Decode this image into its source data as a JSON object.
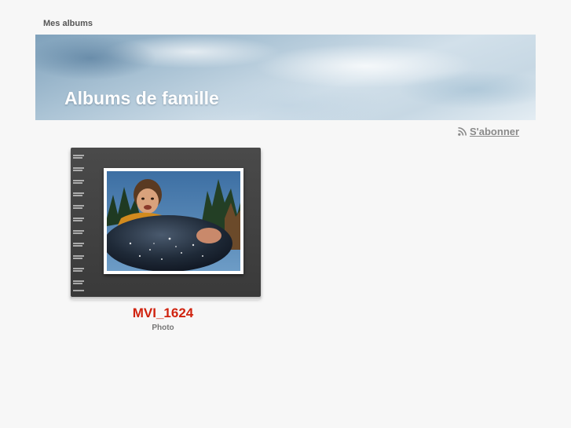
{
  "breadcrumb": {
    "label": "Mes albums"
  },
  "banner": {
    "title": "Albums de famille"
  },
  "subscribe": {
    "label": "S'abonner",
    "icon": "rss-icon"
  },
  "albums": [
    {
      "title": "MVI_1624",
      "type": "Photo",
      "thumbnail": "photo of a child riding a dark inner tube in the snow"
    }
  ],
  "colors": {
    "background": "#f7f7f7",
    "album_title": "#d0230f",
    "banner_title": "#ffffff",
    "muted_text": "#8a8a8a"
  }
}
